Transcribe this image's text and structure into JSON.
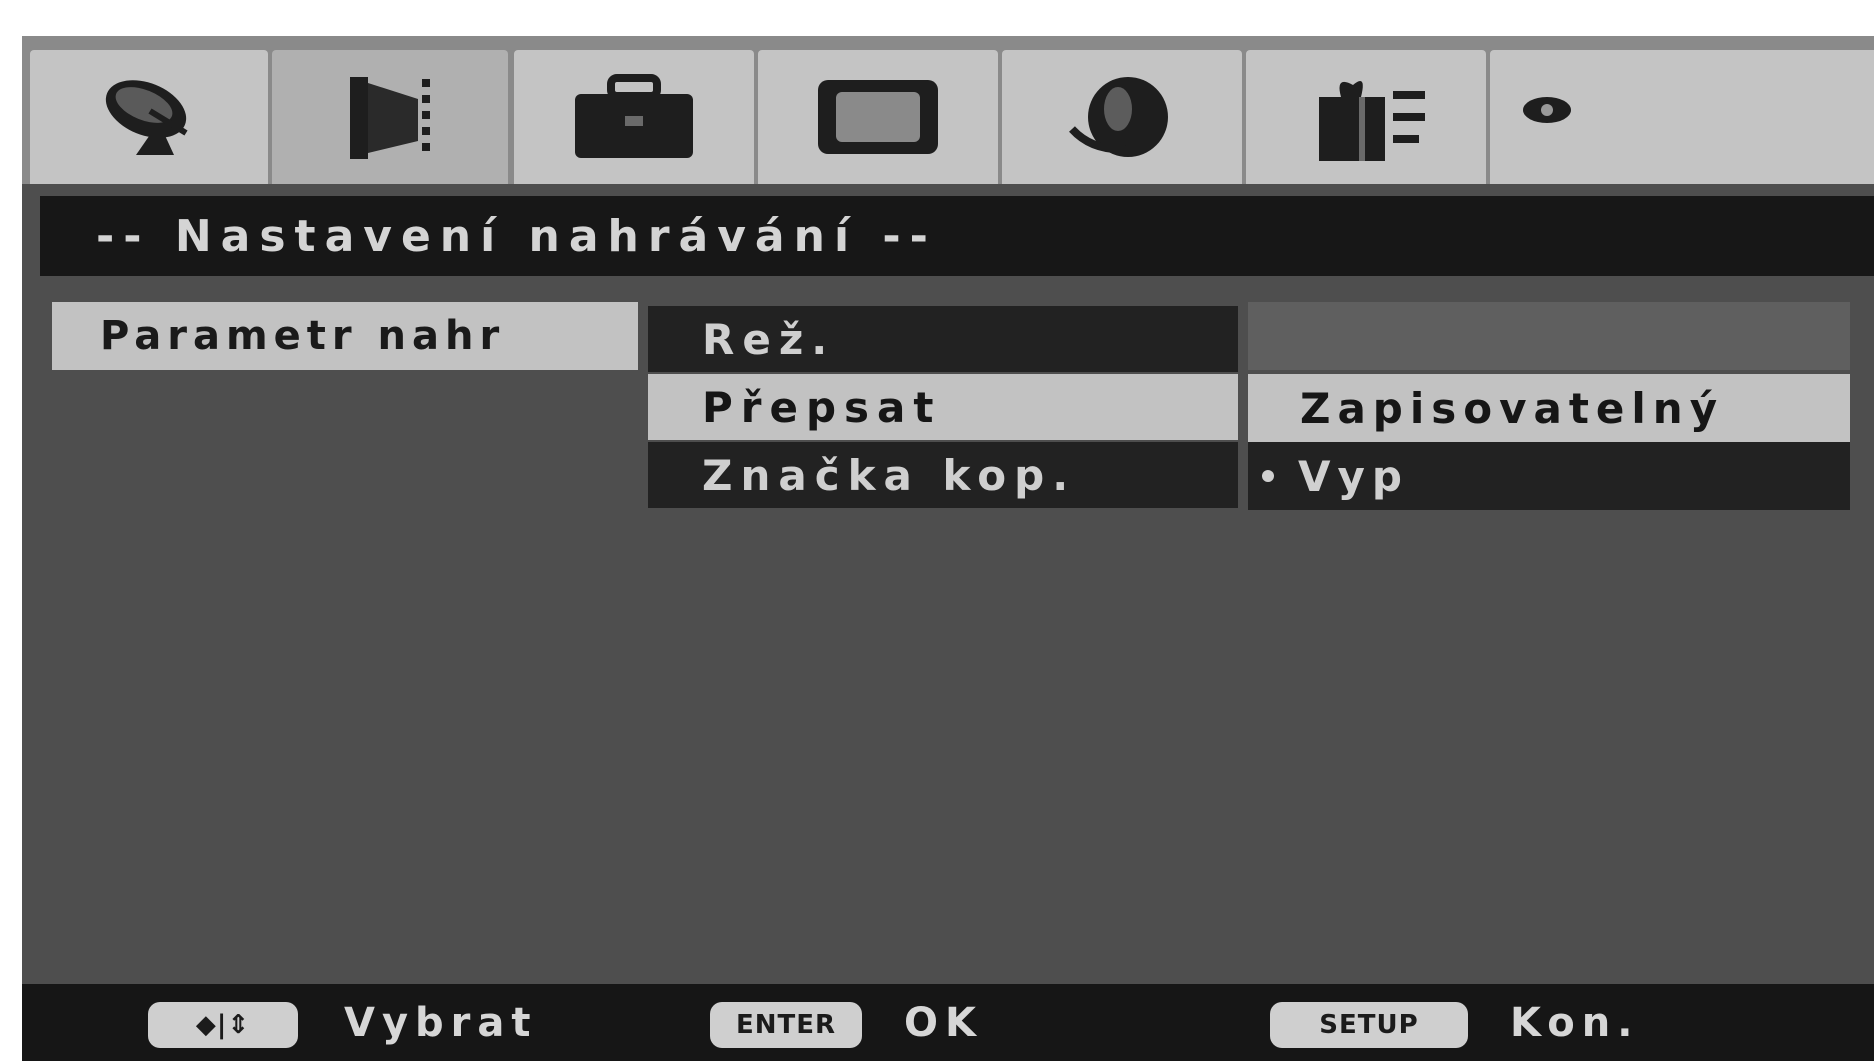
{
  "tabs": [
    {
      "icon": "satellite-dish-icon"
    },
    {
      "icon": "film-strip-icon"
    },
    {
      "icon": "briefcase-icon"
    },
    {
      "icon": "tv-screen-icon"
    },
    {
      "icon": "globe-icon"
    },
    {
      "icon": "gift-box-icon"
    },
    {
      "icon": "eye-icon"
    }
  ],
  "title": "-- Nastavení nahrávání --",
  "category": {
    "label": "Parametr nahr"
  },
  "parameters": [
    {
      "label": "Rež."
    },
    {
      "label": "Přepsat"
    },
    {
      "label": "Značka kop."
    }
  ],
  "options": [
    {
      "label": "Zapisovatelný"
    },
    {
      "label": "Vyp"
    }
  ],
  "help": {
    "navigate_key": "◆|⇕",
    "navigate_label": "Vybrat",
    "enter_key": "ENTER",
    "enter_label": "OK",
    "setup_key": "SETUP",
    "setup_label": "Kon."
  }
}
